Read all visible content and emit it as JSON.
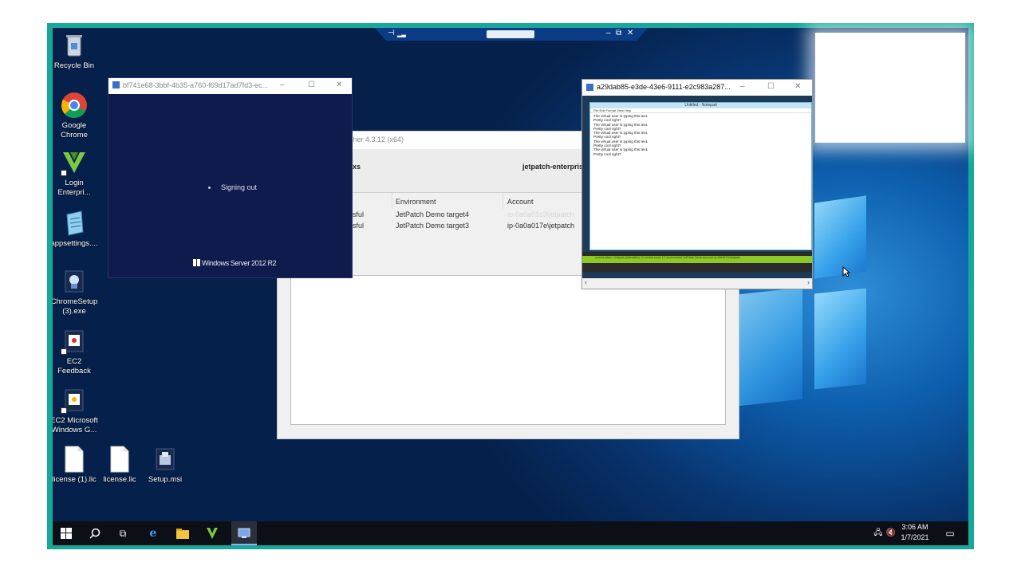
{
  "desktop": {
    "icons": [
      {
        "label": "Recycle Bin",
        "icon": "recycle-bin-icon"
      },
      {
        "label": "Google Chrome",
        "icon": "chrome-icon"
      },
      {
        "label": "Login Enterpri...",
        "icon": "loginvsi-icon"
      },
      {
        "label": "appsettings....",
        "icon": "notepad-file-icon"
      },
      {
        "label": "ChromeSetup (3).exe",
        "icon": "installer-icon"
      },
      {
        "label": "EC2 Feedback",
        "icon": "ec2-feedback-icon"
      },
      {
        "label": "EC2 Microsoft Windows G...",
        "icon": "ec2-guide-icon"
      },
      {
        "label": "license (1).lic",
        "icon": "file-icon"
      },
      {
        "label": "license.lic",
        "icon": "file-icon"
      },
      {
        "label": "Setup.msi",
        "icon": "msi-icon"
      }
    ]
  },
  "signout_window": {
    "title": "bf741e68-3bbf-4b35-a760-f69d17ad7fd3-ec...",
    "message": "Signing out",
    "brand": "Windows Server 2012 R2"
  },
  "launcher_window": {
    "title": "uncher 4.3.12 (x64)",
    "header_left": "xs",
    "header_right": "jetpatch-enterpris",
    "columns": [
      "Environment",
      "Account"
    ],
    "rows": [
      {
        "status": "sful",
        "environment": "JetPatch Demo target4",
        "account": "ip-0a0a01c3\\jetpatch"
      },
      {
        "status": "sful",
        "environment": "JetPatch Demo target3",
        "account": "ip-0a0a017e\\jetpatch"
      }
    ]
  },
  "notepad_window": {
    "title": "a29dab85-e3de-43e6-9111-e2c983a287...",
    "notepad_title": "Untitled - Notepad",
    "menu": "File   Edit   Format   View   Help",
    "lines": [
      "The virtual user is typing this text.",
      "Pretty cool right?",
      "The virtual user is typing this text.",
      "Pretty cool right?",
      "The virtual user is typing this text.",
      "Pretty cool right?",
      "The virtual user is typing this text.",
      "Pretty cool right?",
      "The virtual user is typing this text.",
      "Pretty cool right?"
    ],
    "status_bar": "current action: Notepad (Alternative)    1/1      restart count  1/1      environment: JetPatch Demo   account: ip-0a0a017e\\jetpatch"
  },
  "taskbar": {
    "time": "3:06 AM",
    "date": "1/7/2021"
  },
  "colors": {
    "frame": "#17a89a",
    "taskbar": "#0c0f16",
    "signout_bg": "#0f1b4c",
    "status_green": "#8ac926"
  }
}
